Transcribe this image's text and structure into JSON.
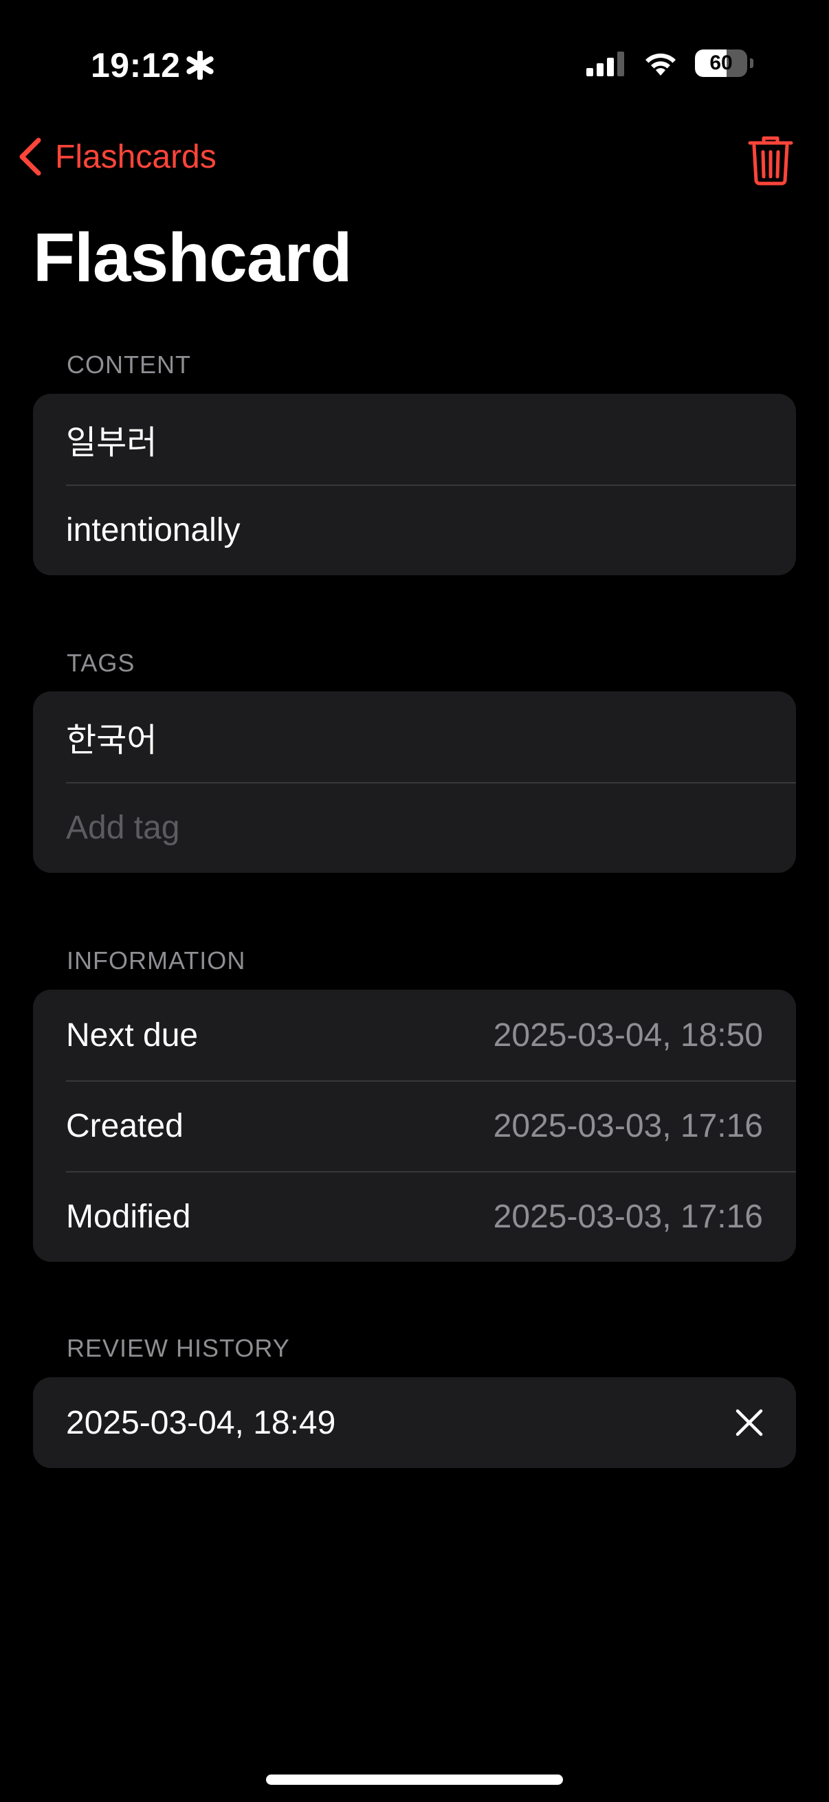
{
  "status_bar": {
    "time": "19:12",
    "battery_level": "60",
    "battery_fraction": 0.6
  },
  "nav": {
    "back_label": "Flashcards",
    "title": "Flashcard",
    "accent_color": "#ff453a"
  },
  "content": {
    "header": "CONTENT",
    "front": "일부러",
    "back": "intentionally"
  },
  "tags": {
    "header": "TAGS",
    "items": [
      "한국어"
    ],
    "add_placeholder": "Add tag"
  },
  "information": {
    "header": "INFORMATION",
    "rows": [
      {
        "label": "Next due",
        "value": "2025-03-04, 18:50"
      },
      {
        "label": "Created",
        "value": "2025-03-03, 17:16"
      },
      {
        "label": "Modified",
        "value": "2025-03-03, 17:16"
      }
    ]
  },
  "review_history": {
    "header": "REVIEW HISTORY",
    "entries": [
      "2025-03-04, 18:49"
    ]
  }
}
